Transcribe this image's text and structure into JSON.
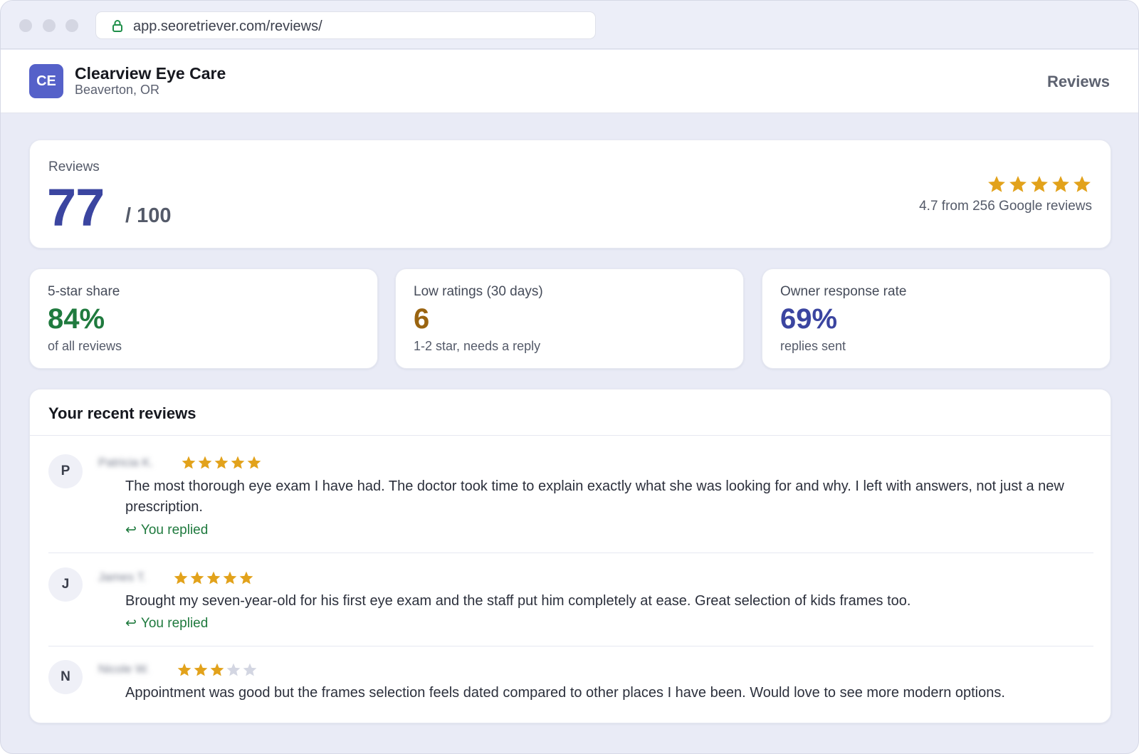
{
  "browser": {
    "url": "app.seoretriever.com/reviews/"
  },
  "header": {
    "avatar_initials": "CE",
    "business_name": "Clearview Eye Care",
    "location": "Beaverton, OR",
    "nav_label": "Reviews"
  },
  "score": {
    "label": "Reviews",
    "value": "77",
    "max": "/ 100",
    "stars_filled": 5,
    "rating_text": "4.7 from 256 Google reviews"
  },
  "metrics": [
    {
      "label": "5-star share",
      "value": "84%",
      "sub": "of all reviews",
      "color": "#1f7a3e"
    },
    {
      "label": "Low ratings (30 days)",
      "value": "6",
      "sub": "1-2 star, needs a reply",
      "color": "#9a6410"
    },
    {
      "label": "Owner response rate",
      "value": "69%",
      "sub": "replies sent",
      "color": "#3b45a0"
    }
  ],
  "reviews_section": {
    "title": "Your recent reviews",
    "items": [
      {
        "initial": "P",
        "reviewer": "Patricia K.",
        "rating": 5,
        "text": "The most thorough eye exam I have had. The doctor took time to explain exactly what she was looking for and why. I left with answers, not just a new prescription.",
        "replied": "You replied"
      },
      {
        "initial": "J",
        "reviewer": "James T.",
        "rating": 5,
        "text": "Brought my seven-year-old for his first eye exam and the staff put him completely at ease. Great selection of kids frames too.",
        "replied": "You replied"
      },
      {
        "initial": "N",
        "reviewer": "Nicole W.",
        "rating": 3,
        "text": "Appointment was good but the frames selection feels dated compared to other places I have been. Would love to see more modern options.",
        "replied": ""
      }
    ]
  },
  "colors": {
    "star_filled": "#e2a21b",
    "star_empty": "#d3d6e2",
    "accent": "#3b45a0"
  },
  "icons": {
    "lock": "lock-icon",
    "star": "star-icon",
    "reply": "reply-arrow-icon"
  }
}
